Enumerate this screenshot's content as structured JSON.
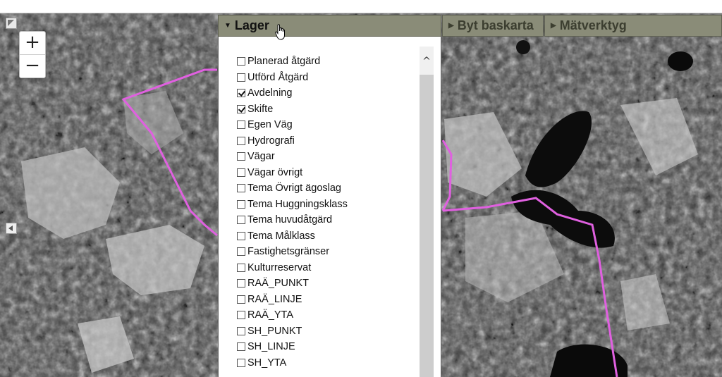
{
  "map": {
    "zoom_in": "+",
    "zoom_out": "−",
    "road_color": "#e060e0"
  },
  "tabs": [
    {
      "label": "Lager",
      "active": true
    },
    {
      "label": "Byt baskarta",
      "active": false
    },
    {
      "label": "Mätverktyg",
      "active": false
    }
  ],
  "layers": [
    {
      "label": "Planerad åtgärd",
      "checked": false
    },
    {
      "label": "Utförd Åtgärd",
      "checked": false
    },
    {
      "label": "Avdelning",
      "checked": true
    },
    {
      "label": "Skifte",
      "checked": true
    },
    {
      "label": "Egen Väg",
      "checked": false
    },
    {
      "label": "Hydrografi",
      "checked": false
    },
    {
      "label": "Vägar",
      "checked": false
    },
    {
      "label": "Vägar övrigt",
      "checked": false
    },
    {
      "label": "Tema Övrigt ägoslag",
      "checked": false
    },
    {
      "label": "Tema Huggningsklass",
      "checked": false
    },
    {
      "label": "Tema huvudåtgärd",
      "checked": false
    },
    {
      "label": "Tema Målklass",
      "checked": false
    },
    {
      "label": "Fastighetsgränser",
      "checked": false
    },
    {
      "label": "Kulturreservat",
      "checked": false
    },
    {
      "label": "RAÄ_PUNKT",
      "checked": false
    },
    {
      "label": "RAÄ_LINJE",
      "checked": false
    },
    {
      "label": "RAÄ_YTA",
      "checked": false
    },
    {
      "label": "SH_PUNKT",
      "checked": false
    },
    {
      "label": "SH_LINJE",
      "checked": false
    },
    {
      "label": "SH_YTA",
      "checked": false
    }
  ],
  "scrollbar": {
    "up_arrow": "^"
  }
}
